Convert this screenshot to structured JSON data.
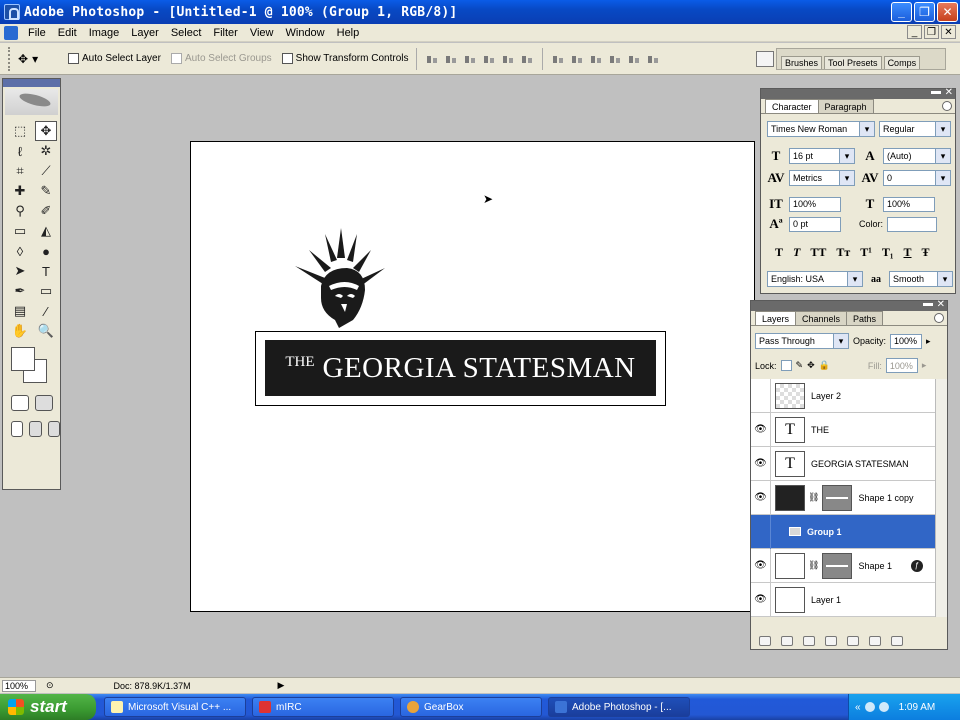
{
  "window": {
    "title": "Adobe Photoshop - [Untitled-1 @ 100% (Group 1, RGB/8)]"
  },
  "menu": [
    "File",
    "Edit",
    "Image",
    "Layer",
    "Select",
    "Filter",
    "View",
    "Window",
    "Help"
  ],
  "options": {
    "auto_select_layer": "Auto Select Layer",
    "auto_select_groups": "Auto Select Groups",
    "show_transform_controls": "Show Transform Controls",
    "palette_well_tabs": [
      "Brushes",
      "Tool Presets",
      "Comps"
    ]
  },
  "canvas": {
    "logo_the": "THE",
    "logo_name": "GEORGIA STATESMAN"
  },
  "character_panel": {
    "tabs": [
      "Character",
      "Paragraph"
    ],
    "font_family": "Times New Roman",
    "font_style": "Regular",
    "font_size": "16 pt",
    "leading": "(Auto)",
    "kerning": "Metrics",
    "tracking": "0",
    "vertical_scale": "100%",
    "horizontal_scale": "100%",
    "baseline_shift": "0 pt",
    "color_label": "Color:",
    "language": "English: USA",
    "antialias": "Smooth",
    "style_buttons": [
      "T",
      "T",
      "TT",
      "Tт",
      "T¹",
      "T₁",
      "T",
      "Ŧ"
    ]
  },
  "layers_panel": {
    "tabs": [
      "Layers",
      "Channels",
      "Paths"
    ],
    "blend_mode": "Pass Through",
    "opacity_label": "Opacity:",
    "opacity": "100%",
    "lock_label": "Lock:",
    "fill_label": "Fill:",
    "fill": "100%",
    "layers": [
      {
        "name": "Layer 2"
      },
      {
        "name": "THE"
      },
      {
        "name": "GEORGIA STATESMAN"
      },
      {
        "name": "Shape 1 copy"
      },
      {
        "name": "Group 1"
      },
      {
        "name": "Shape 1"
      },
      {
        "name": "Layer 1"
      }
    ]
  },
  "status": {
    "zoom": "100%",
    "doc": "Doc: 878.9K/1.37M"
  },
  "taskbar": {
    "start": "start",
    "tasks": [
      "Microsoft Visual C++ ...",
      "mIRC",
      "GearBox",
      "Adobe Photoshop - [..."
    ],
    "clock": "1:09 AM"
  }
}
